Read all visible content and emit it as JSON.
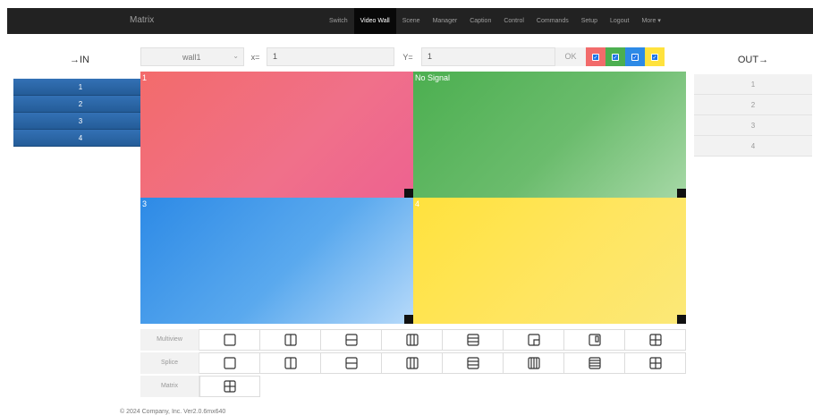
{
  "nav": {
    "brand": "Matrix",
    "links": [
      {
        "label": "Switch",
        "active": false
      },
      {
        "label": "Video Wall",
        "active": true
      },
      {
        "label": "Scene",
        "active": false
      },
      {
        "label": "Manager",
        "active": false
      },
      {
        "label": "Caption",
        "active": false
      },
      {
        "label": "Control",
        "active": false
      },
      {
        "label": "Commands",
        "active": false
      },
      {
        "label": "Setup",
        "active": false
      },
      {
        "label": "Logout",
        "active": false
      },
      {
        "label": "More ▾",
        "active": false
      }
    ]
  },
  "inputs": {
    "title": "→IN",
    "items": [
      "1",
      "2",
      "3",
      "4"
    ]
  },
  "outputs": {
    "title": "OUT→",
    "items": [
      "1",
      "2",
      "3",
      "4"
    ]
  },
  "toolbar": {
    "wall_value": "wall1",
    "x_label": "x=",
    "x_value": "1",
    "y_label": "Y=",
    "y_value": "1",
    "ok_label": "OK",
    "color_toggles": [
      {
        "color": "#f26b6b",
        "checked": true
      },
      {
        "color": "#4caf50",
        "checked": true
      },
      {
        "color": "#2d8ae6",
        "checked": true
      },
      {
        "color": "#ffe23d",
        "checked": true
      }
    ]
  },
  "screens": [
    {
      "label": "1",
      "color": "#f36b6b"
    },
    {
      "label": "No Signal",
      "color": "#4caf50"
    },
    {
      "label": "3",
      "color": "#2d8ae6"
    },
    {
      "label": "4",
      "color": "#ffe23d"
    }
  ],
  "layouts": {
    "multiview": {
      "label": "Multiview",
      "icons": [
        "single-layout-icon",
        "split-vertical-2-icon",
        "split-horizontal-2-icon",
        "split-vertical-3-icon",
        "split-horizontal-3-icon",
        "pip-corner-icon",
        "pip-side-icon",
        "grid-2x2-icon"
      ]
    },
    "splice": {
      "label": "Splice",
      "icons": [
        "single-layout-icon",
        "split-vertical-2-icon",
        "split-horizontal-2-icon",
        "split-vertical-3-icon",
        "split-horizontal-3-icon",
        "split-vertical-4-icon",
        "split-horizontal-4-icon",
        "grid-2x2-icon"
      ]
    },
    "matrix": {
      "label": "Matrix",
      "icons": [
        "grid-2x2-icon"
      ]
    }
  },
  "footer": "© 2024 Company, Inc. Ver2.0.6mx640"
}
